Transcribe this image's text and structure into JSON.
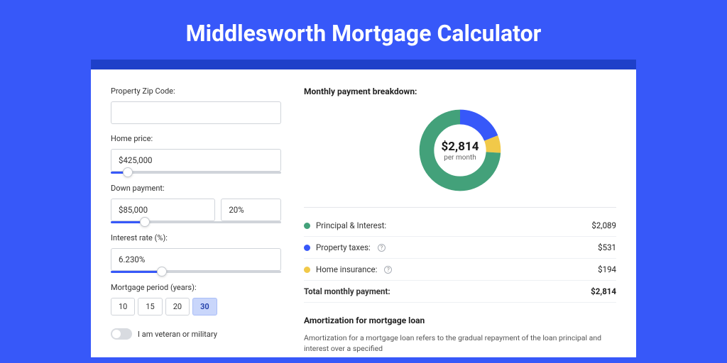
{
  "pageTitle": "Middlesworth Mortgage Calculator",
  "form": {
    "zip": {
      "label": "Property Zip Code:",
      "value": ""
    },
    "homePrice": {
      "label": "Home price:",
      "value": "$425,000",
      "sliderPct": 10
    },
    "downPayment": {
      "label": "Down payment:",
      "amount": "$85,000",
      "percent": "20%",
      "sliderPct": 20
    },
    "interest": {
      "label": "Interest rate (%):",
      "value": "6.230%",
      "sliderPct": 30
    },
    "period": {
      "label": "Mortgage period (years):",
      "options": [
        "10",
        "15",
        "20",
        "30"
      ],
      "active": 3
    },
    "veteran": {
      "label": "I am veteran or military",
      "on": false
    }
  },
  "breakdown": {
    "heading": "Monthly payment breakdown:",
    "centerAmount": "$2,814",
    "centerSub": "per month",
    "items": [
      {
        "label": "Principal & Interest:",
        "value": "$2,089",
        "color": "#43a17a",
        "hasInfo": false,
        "pct": 74
      },
      {
        "label": "Property taxes:",
        "value": "$531",
        "color": "#3758f9",
        "hasInfo": true,
        "pct": 19
      },
      {
        "label": "Home insurance:",
        "value": "$194",
        "color": "#f1c949",
        "hasInfo": true,
        "pct": 7
      }
    ],
    "totalLabel": "Total monthly payment:",
    "totalValue": "$2,814"
  },
  "amortization": {
    "heading": "Amortization for mortgage loan",
    "body": "Amortization for a mortgage loan refers to the gradual repayment of the loan principal and interest over a specified"
  }
}
